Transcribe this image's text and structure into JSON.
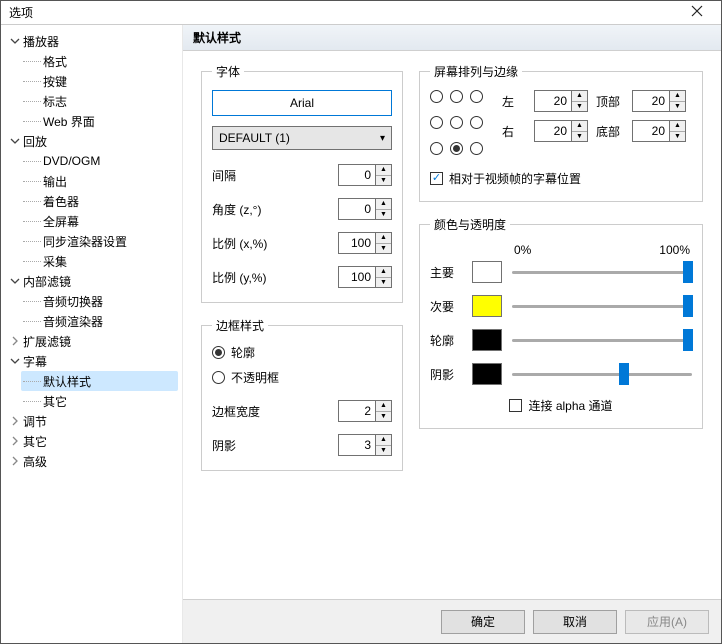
{
  "window": {
    "title": "选项"
  },
  "tree": {
    "nodes": [
      {
        "label": "播放器",
        "expanded": true,
        "children": [
          "格式",
          "按键",
          "标志",
          "Web 界面"
        ]
      },
      {
        "label": "回放",
        "expanded": true,
        "children": [
          "DVD/OGM",
          "输出",
          "着色器",
          "全屏幕",
          "同步渲染器设置",
          "采集"
        ]
      },
      {
        "label": "内部滤镜",
        "expanded": true,
        "children": [
          "音频切换器",
          "音频渲染器"
        ]
      },
      {
        "label": "扩展滤镜",
        "expanded": false
      },
      {
        "label": "字幕",
        "expanded": true,
        "children": [
          "默认样式",
          "其它"
        ],
        "selectedChild": 0
      },
      {
        "label": "调节",
        "expanded": false
      },
      {
        "label": "其它",
        "expanded": false
      },
      {
        "label": "高级",
        "expanded": false
      }
    ]
  },
  "panel": {
    "title": "默认样式"
  },
  "font_group": {
    "legend": "字体",
    "font_button": "Arial",
    "charset_select": "DEFAULT (1)",
    "spacing_label": "间隔",
    "spacing_val": "0",
    "angle_label": "角度 (z,°)",
    "angle_val": "0",
    "scalex_label": "比例 (x,%)",
    "scalex_val": "100",
    "scaley_label": "比例 (y,%)",
    "scaley_val": "100"
  },
  "border_group": {
    "legend": "边框样式",
    "opt_outline": "轮廓",
    "opt_opaque": "不透明框",
    "width_label": "边框宽度",
    "width_val": "2",
    "shadow_label": "阴影",
    "shadow_val": "3",
    "selected": "outline"
  },
  "align_group": {
    "legend": "屏幕排列与边缘",
    "left_lbl": "左",
    "left_val": "20",
    "right_lbl": "右",
    "right_val": "20",
    "top_lbl": "顶部",
    "top_val": "20",
    "bottom_lbl": "底部",
    "bottom_val": "20",
    "relative_checked": true,
    "relative_label": "相对于视频帧的字幕位置",
    "selected_cell": 7
  },
  "color_group": {
    "legend": "颜色与透明度",
    "pct0": "0%",
    "pct100": "100%",
    "rows": [
      {
        "label": "主要",
        "swatch": "#ffffff",
        "pos": 98
      },
      {
        "label": "次要",
        "swatch": "#ffff00",
        "pos": 98
      },
      {
        "label": "轮廓",
        "swatch": "#000000",
        "pos": 98
      },
      {
        "label": "阴影",
        "swatch": "#000000",
        "pos": 62
      }
    ],
    "link_label": "连接 alpha 通道",
    "link_checked": false
  },
  "footer": {
    "ok": "确定",
    "cancel": "取消",
    "apply": "应用(A)"
  }
}
